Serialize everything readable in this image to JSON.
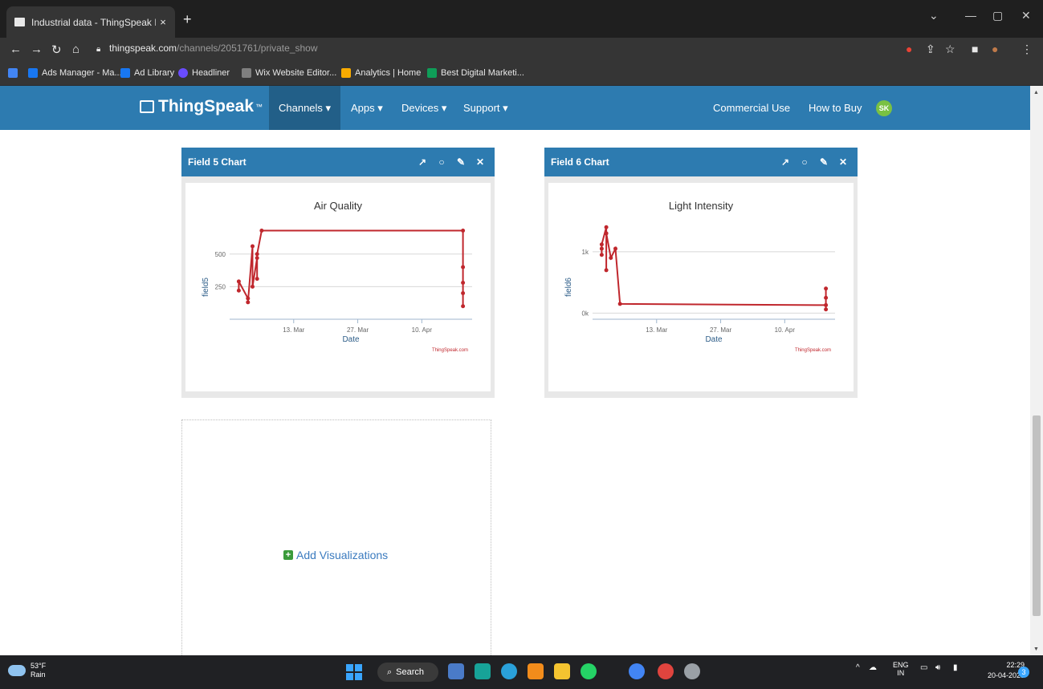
{
  "browser": {
    "tab_title": "Industrial data - ThingSpeak IoT",
    "tab_close": "×",
    "new_tab": "+",
    "url_host": "thingspeak.com",
    "url_path": "/channels/2051761/private_show",
    "bookmarks": [
      {
        "label": "Ads Manager - Ma...",
        "color": "#1877f2"
      },
      {
        "label": "Ad Library",
        "color": "#1877f2"
      },
      {
        "label": "Headliner",
        "color": "#6a4cff"
      },
      {
        "label": "Wix Website Editor...",
        "color": "#7f7f7f"
      },
      {
        "label": "Analytics | Home",
        "color": "#f9ab00"
      },
      {
        "label": "Best Digital Marketi...",
        "color": "#0f9d58"
      }
    ]
  },
  "header": {
    "logo": "ThingSpeak",
    "tm": "™",
    "nav": [
      {
        "label": "Channels ▾"
      },
      {
        "label": "Apps ▾"
      },
      {
        "label": "Devices ▾"
      },
      {
        "label": "Support ▾"
      }
    ],
    "commercial": "Commercial Use",
    "howtobuy": "How to Buy",
    "avatar": "SK"
  },
  "widgets": [
    {
      "title": "Field 5 Chart"
    },
    {
      "title": "Field 6 Chart"
    }
  ],
  "add_visualizations": "Add Visualizations",
  "chart_data": [
    {
      "type": "line",
      "title": "Air Quality",
      "xlabel": "Date",
      "ylabel": "field5",
      "xticks": [
        "13. Mar",
        "27. Mar",
        "10. Apr"
      ],
      "yticks": [
        "250",
        "500"
      ],
      "credit": "ThingSpeak.com",
      "color": "#c0272d",
      "points": [
        {
          "x": "2023-03-01",
          "y": 220
        },
        {
          "x": "2023-03-01",
          "y": 290
        },
        {
          "x": "2023-03-03",
          "y": 160
        },
        {
          "x": "2023-03-03",
          "y": 130
        },
        {
          "x": "2023-03-04",
          "y": 560
        },
        {
          "x": "2023-03-04",
          "y": 250
        },
        {
          "x": "2023-03-05",
          "y": 470
        },
        {
          "x": "2023-03-05",
          "y": 310
        },
        {
          "x": "2023-03-05",
          "y": 500
        },
        {
          "x": "2023-03-06",
          "y": 680
        },
        {
          "x": "2023-04-19",
          "y": 680
        },
        {
          "x": "2023-04-19",
          "y": 400
        },
        {
          "x": "2023-04-19",
          "y": 280
        },
        {
          "x": "2023-04-19",
          "y": 200
        },
        {
          "x": "2023-04-19",
          "y": 100
        }
      ]
    },
    {
      "type": "line",
      "title": "Light Intensity",
      "xlabel": "Date",
      "ylabel": "field6",
      "xticks": [
        "13. Mar",
        "27. Mar",
        "10. Apr"
      ],
      "yticks": [
        "0k",
        "1k"
      ],
      "credit": "ThingSpeak.com",
      "color": "#c0272d",
      "points": [
        {
          "x": "2023-03-01",
          "y": 1050
        },
        {
          "x": "2023-03-01",
          "y": 950
        },
        {
          "x": "2023-03-01",
          "y": 1120
        },
        {
          "x": "2023-03-02",
          "y": 1400
        },
        {
          "x": "2023-03-02",
          "y": 700
        },
        {
          "x": "2023-03-02",
          "y": 1300
        },
        {
          "x": "2023-03-03",
          "y": 900
        },
        {
          "x": "2023-03-04",
          "y": 1050
        },
        {
          "x": "2023-03-05",
          "y": 150
        },
        {
          "x": "2023-04-19",
          "y": 130
        },
        {
          "x": "2023-04-19",
          "y": 400
        },
        {
          "x": "2023-04-19",
          "y": 250
        },
        {
          "x": "2023-04-19",
          "y": 60
        }
      ]
    }
  ],
  "taskbar": {
    "temp": "53°F",
    "weather": "Rain",
    "search": "Search",
    "lang1": "ENG",
    "lang2": "IN",
    "time": "22:29",
    "date": "20-04-2023",
    "notif": "3"
  }
}
